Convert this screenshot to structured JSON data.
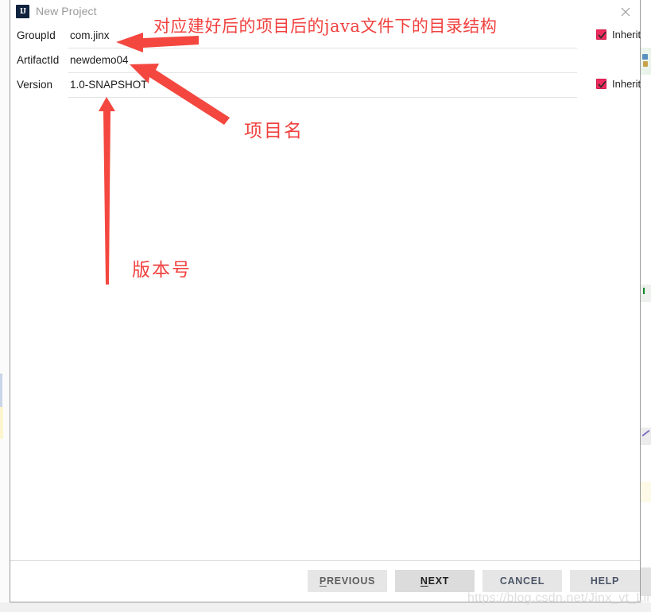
{
  "window": {
    "title": "New Project",
    "logo_icon": "intellij-idea-logo",
    "logo_text": "IJ",
    "close_icon": "close-icon"
  },
  "form": {
    "rows": [
      {
        "label": "GroupId",
        "value": "com.jinx",
        "inherit_label": "Inherit",
        "inherit_checked": true
      },
      {
        "label": "ArtifactId",
        "value": "newdemo04",
        "inherit_label": "",
        "inherit_checked": false
      },
      {
        "label": "Version",
        "value": "1.0-SNAPSHOT",
        "inherit_label": "Inherit",
        "inherit_checked": true
      }
    ]
  },
  "annotations": {
    "top": "对应建好后的项目后的java文件下的目录结构",
    "project_name": "项目名",
    "version_number": "版本号",
    "color": "#f0423f"
  },
  "footer": {
    "previous": {
      "prefix": "",
      "mnemonic": "P",
      "rest": "REVIOUS"
    },
    "next": {
      "prefix": "",
      "mnemonic": "N",
      "rest": "EXT"
    },
    "cancel": {
      "prefix": "",
      "mnemonic": "",
      "rest": "CANCEL"
    },
    "help": {
      "prefix": "",
      "mnemonic": "",
      "rest": "HELP"
    }
  },
  "watermark": "https://blog.csdn.net/Jinx_vt_Lin",
  "colors": {
    "accent_checkbox": "#ef2b5e",
    "annotation_red": "#f0423f",
    "dialog_bg": "#ffffff",
    "button_bg": "#e4e4e4"
  }
}
